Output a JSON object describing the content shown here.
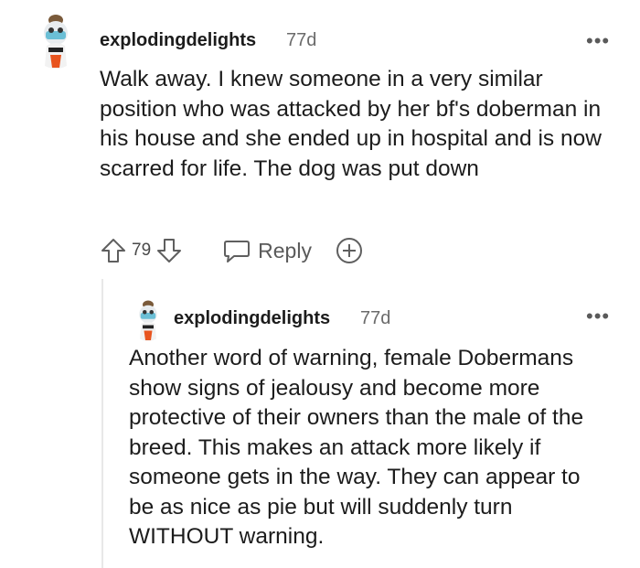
{
  "comment": {
    "username": "explodingdelights",
    "age": "77d",
    "text": "Walk away. I knew someone in a very similar position who was attacked by her bf's doberman in his house and she ended up in hospital and is now scarred for life. The dog was put down",
    "vote_count": "79",
    "reply_label": "Reply"
  },
  "reply": {
    "username": "explodingdelights",
    "age": "77d",
    "text": "Another word of warning, female Dobermans show signs of jealousy and become more protective of their owners than the male of the breed. This makes an attack more likely if someone gets in the way. They can appear to be as nice as pie but will suddenly turn WITHOUT warning."
  },
  "icons": {
    "upvote": "arrow-up-icon",
    "downvote": "arrow-down-icon",
    "reply": "speech-bubble-icon",
    "award": "plus-circle-icon",
    "more": "ellipsis-icon"
  },
  "colors": {
    "text": "#1c1c1c",
    "muted": "#6b6b6b",
    "thread_line": "#e8e8e8"
  }
}
